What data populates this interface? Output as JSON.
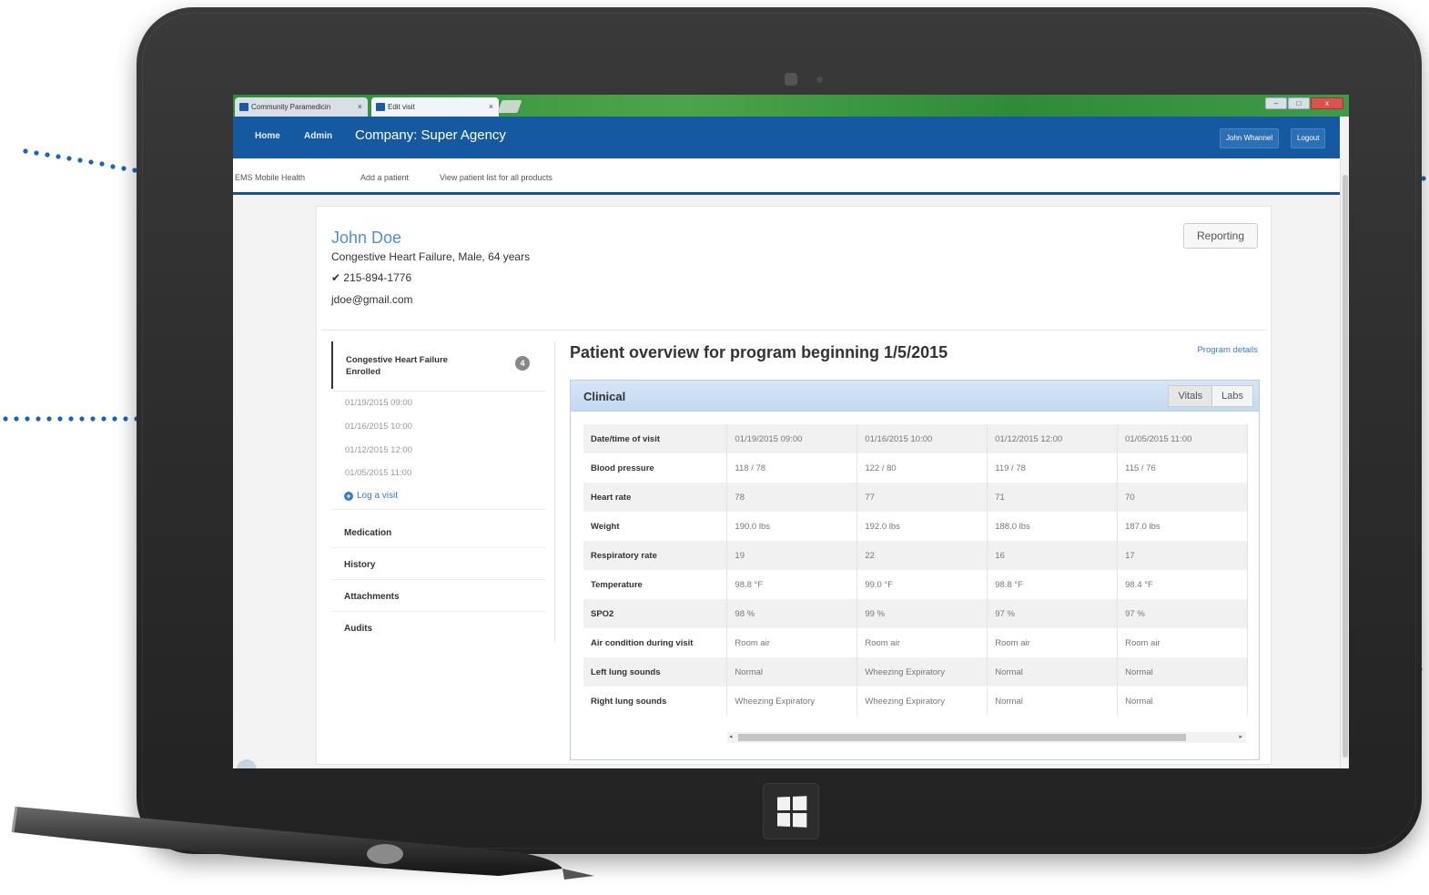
{
  "browser": {
    "tabs": [
      {
        "label": "Community Paramedicin",
        "close": "×"
      },
      {
        "label": "Edit visit",
        "close": "×"
      }
    ]
  },
  "topnav": {
    "home": "Home",
    "admin": "Admin",
    "company": "Company: Super Agency",
    "user": "John Whannel",
    "logout": "Logout"
  },
  "subnav": {
    "ems": "EMS Mobile Health",
    "add_patient": "Add a patient",
    "view_list": "View patient list for all products"
  },
  "patient": {
    "name": "John Doe",
    "summary": "Congestive Heart Failure, Male, 64 years",
    "phone": "✔ 215-894-1776",
    "email": "jdoe@gmail.com"
  },
  "reporting_button": "Reporting",
  "program": {
    "title": "Congestive Heart Failure Enrolled",
    "badge": "4",
    "visits": [
      "01/19/2015 09:00",
      "01/16/2015 10:00",
      "01/12/2015 12:00",
      "01/05/2015 11:00"
    ],
    "log_visit": "Log a visit"
  },
  "sections": [
    "Medication",
    "History",
    "Attachments",
    "Audits"
  ],
  "overview": {
    "title": "Patient overview for program beginning 1/5/2015",
    "program_details": "Program details"
  },
  "clinical": {
    "title": "Clinical",
    "tabs": [
      "Vitals",
      "Labs"
    ],
    "rows": [
      {
        "label": "Date/time of visit",
        "values": [
          "01/19/2015 09:00",
          "01/16/2015 10:00",
          "01/12/2015 12:00",
          "01/05/2015 11:00"
        ]
      },
      {
        "label": "Blood pressure",
        "values": [
          "118 / 78",
          "122 / 80",
          "119 / 78",
          "115 / 76"
        ]
      },
      {
        "label": "Heart rate",
        "values": [
          "78",
          "77",
          "71",
          "70"
        ]
      },
      {
        "label": "Weight",
        "values": [
          "190.0 lbs",
          "192.0 lbs",
          "188.0 lbs",
          "187.0 lbs"
        ]
      },
      {
        "label": "Respiratory rate",
        "values": [
          "19",
          "22",
          "16",
          "17"
        ]
      },
      {
        "label": "Temperature",
        "values": [
          "98.8 °F",
          "99.0 °F",
          "98.8 °F",
          "98.4 °F"
        ]
      },
      {
        "label": "SPO2",
        "values": [
          "98 %",
          "99 %",
          "97 %",
          "97 %"
        ]
      },
      {
        "label": "Air condition during visit",
        "values": [
          "Room air",
          "Room air",
          "Room air",
          "Room air"
        ]
      },
      {
        "label": "Left lung sounds",
        "values": [
          "Normal",
          "Wheezing Expiratory",
          "Normal",
          "Normal"
        ]
      },
      {
        "label": "Right lung sounds",
        "values": [
          "Wheezing Expiratory",
          "Wheezing Expiratory",
          "Normal",
          "Normal"
        ]
      }
    ]
  },
  "colors": {
    "nav_blue": "#155aa0",
    "callout_blue": "#1a66b3",
    "link_blue": "#3a78c0",
    "chrome_green": "#3f9a4a"
  },
  "icons": [
    "favicon-icon",
    "close-icon",
    "check-icon",
    "plus-circle-icon",
    "windows-icon"
  ]
}
